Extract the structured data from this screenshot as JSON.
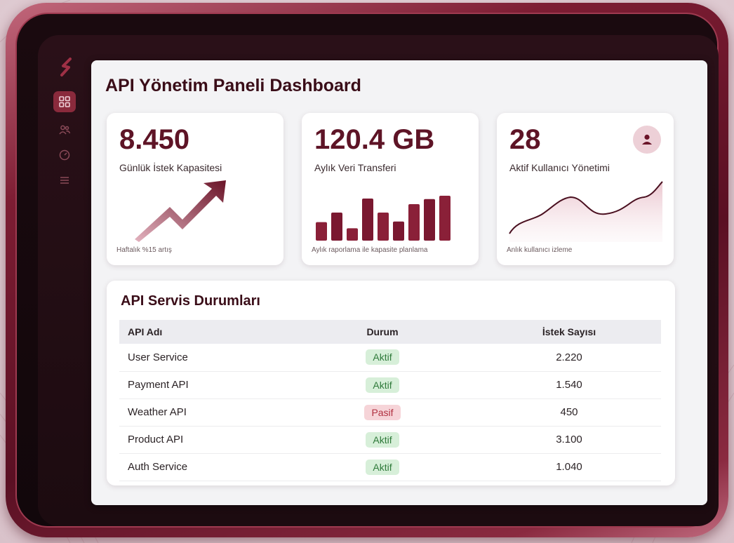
{
  "header": {
    "title": "API Yönetim Paneli Dashboard"
  },
  "sidebar": {
    "items": [
      {
        "icon": "dashboard-icon",
        "active": true
      },
      {
        "icon": "users-icon",
        "active": false
      },
      {
        "icon": "speedometer-icon",
        "active": false
      },
      {
        "icon": "list-icon",
        "active": false
      }
    ]
  },
  "cards": [
    {
      "value": "8.450",
      "label": "Günlük İstek Kapasitesi",
      "note": "Haftalık %15 artış",
      "chart": "trend-arrow"
    },
    {
      "value": "120.4 GB",
      "label": "Aylık Veri Transferi",
      "note": "Aylık raporlama ile kapasite planlama",
      "chart": "bars",
      "bar_levels": [
        0.33,
        0.5,
        0.22,
        0.75,
        0.5,
        0.34,
        0.65,
        0.74,
        0.8
      ]
    },
    {
      "value": "28",
      "label": "Aktif Kullanıcı Yönetimi",
      "note": "Anlık kullanıcı izleme",
      "chart": "area-line"
    }
  ],
  "services": {
    "title": "API Servis Durumları",
    "columns": [
      "API Adı",
      "Durum",
      "İstek Sayısı"
    ],
    "rows": [
      {
        "name": "User Service",
        "status": "Aktif",
        "active": true,
        "requests": "2.220"
      },
      {
        "name": "Payment API",
        "status": "Aktif",
        "active": true,
        "requests": "1.540"
      },
      {
        "name": "Weather API",
        "status": "Pasif",
        "active": false,
        "requests": "450"
      },
      {
        "name": "Product API",
        "status": "Aktif",
        "active": true,
        "requests": "3.100"
      },
      {
        "name": "Auth Service",
        "status": "Aktif",
        "active": true,
        "requests": "1.040"
      }
    ]
  },
  "colors": {
    "accent": "#5e1426",
    "frame": "#7d1d33",
    "active_badge": "#d7efd9",
    "passive_badge": "#f6d4d8"
  }
}
